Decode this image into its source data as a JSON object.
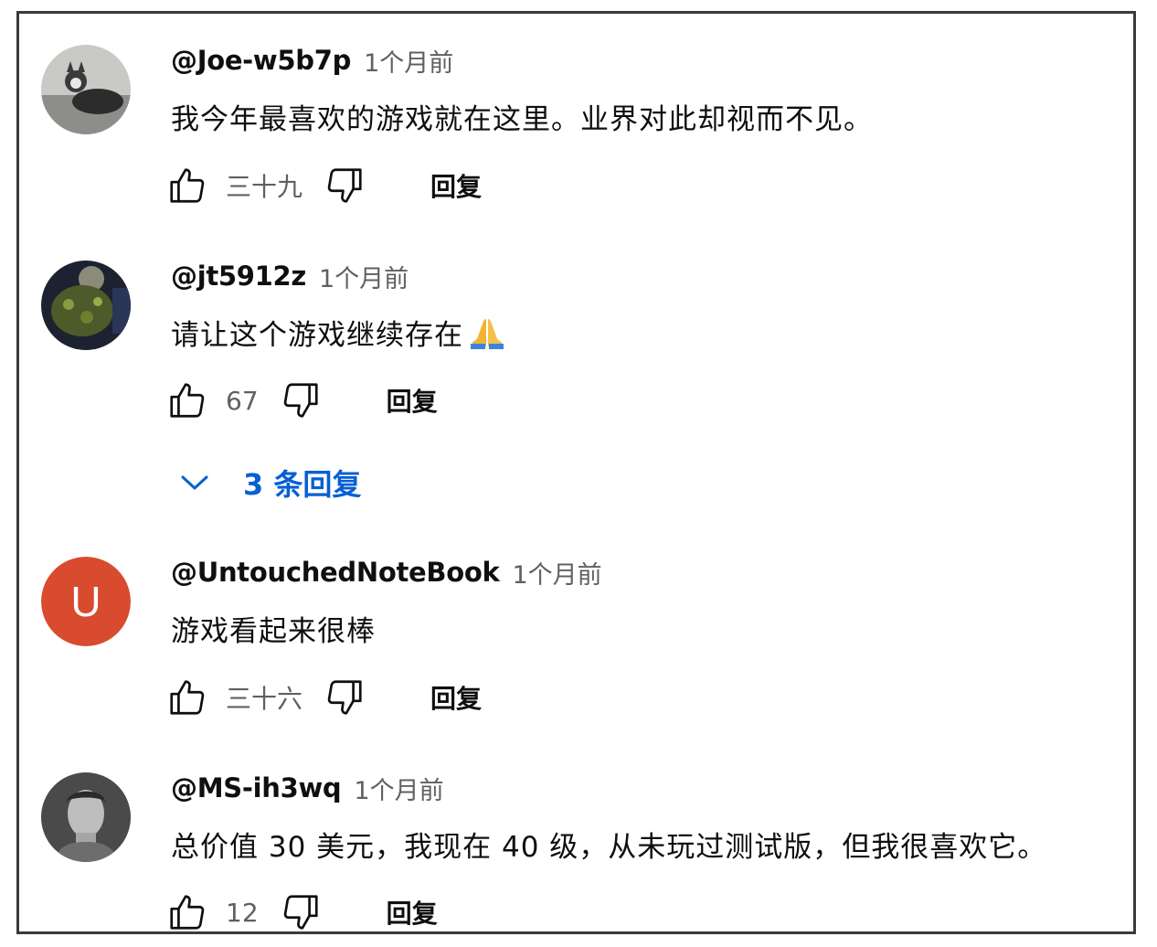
{
  "comments": [
    {
      "author": "@Joe-w5b7p",
      "time": "1个月前",
      "text": "我今年最喜欢的游戏就在这里。业界对此却视而不见。",
      "likes": "三十九",
      "reply_label": "回复"
    },
    {
      "author": "@jt5912z",
      "time": "1个月前",
      "text": "请让这个游戏继续存在",
      "likes": "67",
      "reply_label": "回复",
      "replies_toggle": "3 条回复"
    },
    {
      "author": "@UntouchedNoteBook",
      "time": "1个月前",
      "text": "游戏看起来很棒",
      "likes": "三十六",
      "reply_label": "回复",
      "avatar_letter": "U",
      "avatar_color": "#d84b2f"
    },
    {
      "author": "@MS-ih3wq",
      "time": "1个月前",
      "text": "总价值 30 美元，我现在 40 级，从未玩过测试版，但我很喜欢它。",
      "likes": "12",
      "reply_label": "回复"
    }
  ],
  "icons": {
    "like": "thumbs-up-icon",
    "dislike": "thumbs-down-icon",
    "expand": "chevron-down-icon",
    "emoji": "folded-hands-emoji"
  },
  "colors": {
    "link": "#065fd4",
    "secondary": "#606060"
  }
}
